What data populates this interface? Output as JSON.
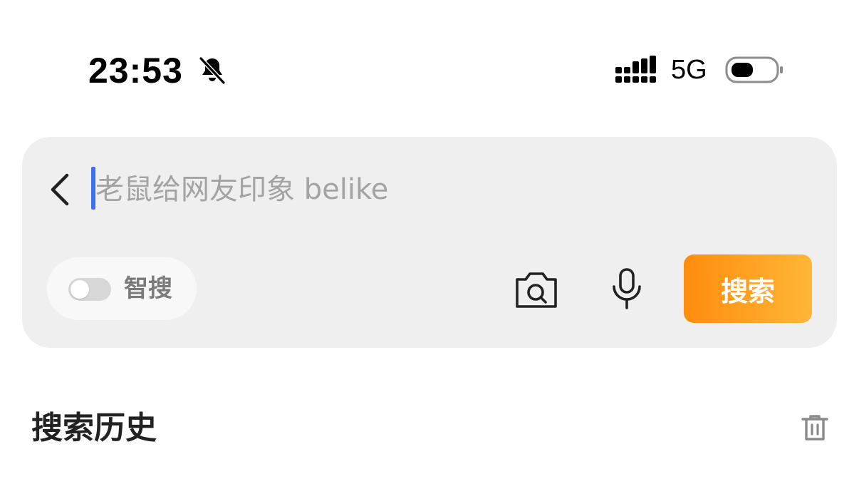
{
  "status_bar": {
    "time": "23:53",
    "network": "5G",
    "icons": [
      "bell-muted-icon",
      "signal-icon",
      "battery-icon"
    ]
  },
  "search": {
    "placeholder": "老鼠给网友印象 belike",
    "value": "",
    "smart_search_label": "智搜",
    "smart_search_enabled": false,
    "submit_label": "搜索",
    "icons": [
      "back-icon",
      "camera-search-icon",
      "microphone-icon"
    ]
  },
  "history": {
    "title": "搜索历史",
    "icons": [
      "trash-icon"
    ]
  },
  "colors": {
    "accent_start": "#ff8c0d",
    "accent_end": "#ffb637",
    "caret": "#3f6ff0",
    "card_bg": "#efefef"
  }
}
